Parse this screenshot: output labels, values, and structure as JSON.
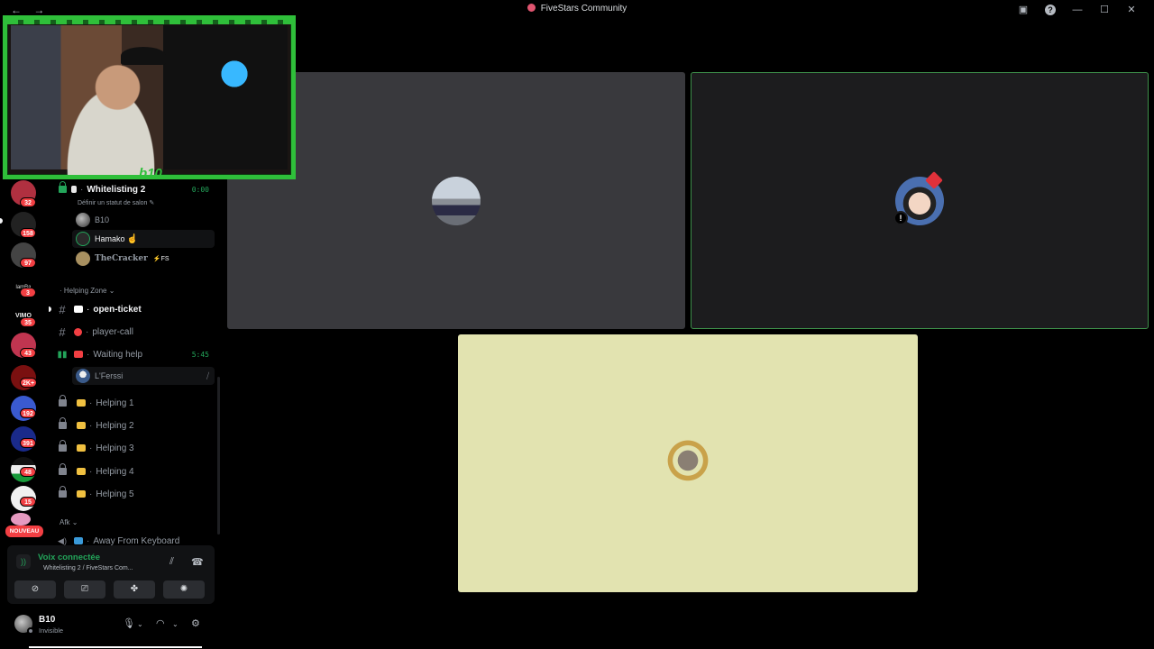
{
  "titlebar": {
    "title": "FiveStars Community",
    "back": "←",
    "forward": "→",
    "help": "?",
    "minimize": "—",
    "maximize": "☐",
    "close": "✕"
  },
  "rail": {
    "badges": [
      "32",
      "158",
      "97",
      "3",
      "35",
      "43",
      "2K+",
      "192",
      "391",
      "48",
      "15"
    ],
    "new_label": "NOUVEAU",
    "server_text": [
      "lamBa",
      "VIMO"
    ]
  },
  "channels": {
    "voice_active": {
      "name": "Whitelisting 2",
      "timer": "0:00",
      "status_hint": "Définir un statut de salon ✎",
      "users": [
        {
          "name": "B10",
          "tag": ""
        },
        {
          "name": "Hamako",
          "tag": ""
        },
        {
          "name": "TheCracker",
          "tag": "⚡FS"
        }
      ]
    },
    "category_helping": "Helping Zone",
    "category_chevron": "⌄",
    "open_ticket": "open-ticket",
    "player_call": "player-call",
    "waiting_help": {
      "name": "Waiting help",
      "timer": "5:45",
      "user": "L'Ferssi"
    },
    "helping": [
      "Helping 1",
      "Helping 2",
      "Helping 3",
      "Helping 4",
      "Helping 5"
    ],
    "category_afk": "Afk",
    "afk_channel": "Away From Keyboard"
  },
  "voice_panel": {
    "title": "Voix connectée",
    "subtitle": "Whitelisting 2 / FiveStars Com...",
    "icons": [
      "noise-suppression-icon",
      "disconnect-icon"
    ],
    "buttons": [
      "camera-off-icon",
      "screen-share-icon",
      "activities-icon",
      "soundboard-icon"
    ]
  },
  "user_panel": {
    "name": "B10",
    "status": "Invisible"
  },
  "stage": {
    "tile_b_mute": "!"
  },
  "webcam": {
    "tag": "b10"
  },
  "colors": {
    "accent_green": "#23a55a",
    "badge_red": "#f23f43",
    "webcam_frame": "#2fbf3a"
  }
}
